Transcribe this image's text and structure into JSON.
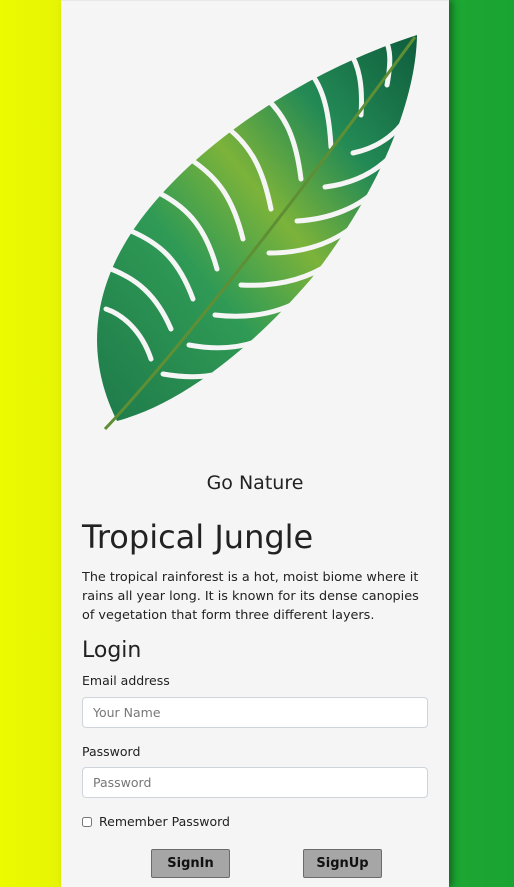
{
  "brand": "Go Nature",
  "title": "Tropical Jungle",
  "description": "The tropical rainforest is a hot, moist biome where it rains all year long. It is known for its dense canopies of vegetation that form three different layers.",
  "login": {
    "heading": "Login",
    "email_label": "Email address",
    "email_placeholder": "Your Name",
    "password_label": "Password",
    "password_placeholder": "Password",
    "remember_label": "Remember Password",
    "signin_label": "SignIn",
    "signup_label": "SignUp"
  },
  "colors": {
    "left_gradient": "#ecfb00",
    "right_gradient": "#1aa331",
    "card_bg": "#f5f5f5",
    "button_bg": "#a6a6a6"
  },
  "image": {
    "icon": "tropical-leaf-illustration"
  }
}
